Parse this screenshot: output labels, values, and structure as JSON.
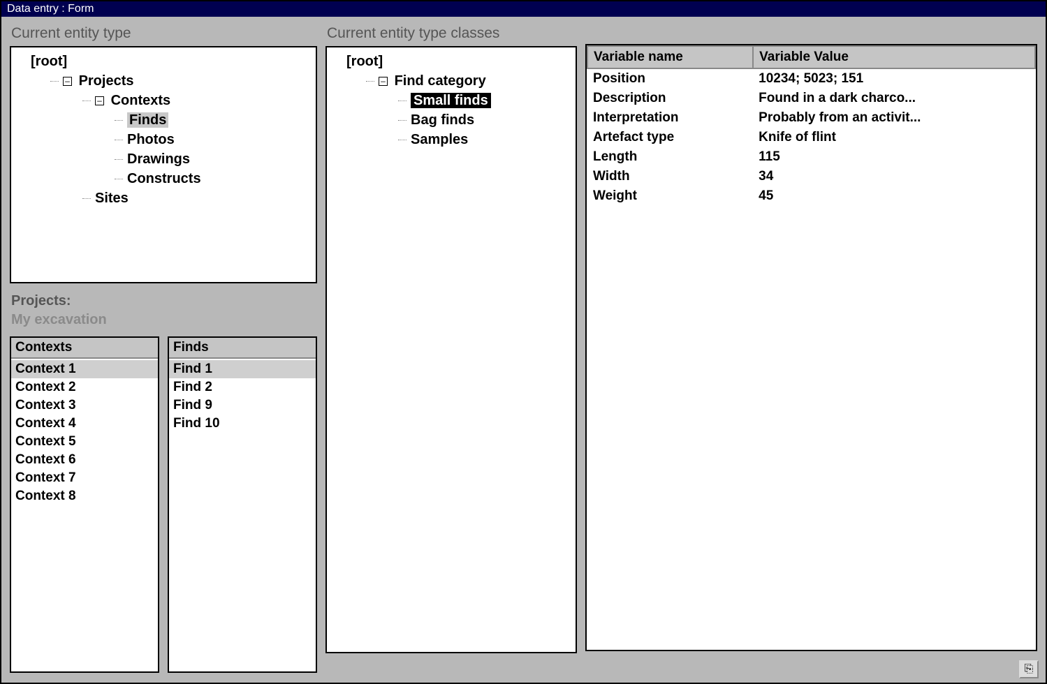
{
  "window": {
    "title": "Data entry : Form"
  },
  "entity_tree": {
    "title": "Current entity type",
    "root_label": "[root]",
    "nodes": {
      "projects": "Projects",
      "contexts": "Contexts",
      "finds": "Finds",
      "photos": "Photos",
      "drawings": "Drawings",
      "constructs": "Constructs",
      "sites": "Sites"
    },
    "selected": "Finds"
  },
  "classes_tree": {
    "title": "Current entity type classes",
    "root_label": "[root]",
    "nodes": {
      "find_category": "Find category",
      "small_finds": "Small finds",
      "bag_finds": "Bag finds",
      "samples": "Samples"
    },
    "selected": "Small finds"
  },
  "projects": {
    "label": "Projects:",
    "current": "My excavation"
  },
  "contexts_list": {
    "header": "Contexts",
    "items": [
      "Context 1",
      "Context 2",
      "Context 3",
      "Context 4",
      "Context 5",
      "Context 6",
      "Context 7",
      "Context 8"
    ],
    "selected_index": 0
  },
  "finds_list": {
    "header": "Finds",
    "items": [
      "Find 1",
      "Find 2",
      "Find 9",
      "Find 10"
    ],
    "selected_index": 0
  },
  "variables": {
    "col_name": "Variable name",
    "col_value": "Variable Value",
    "rows": [
      {
        "name": "Position",
        "value": "10234; 5023; 151"
      },
      {
        "name": "Description",
        "value": "Found in a dark charco..."
      },
      {
        "name": "Interpretation",
        "value": "Probably from an activit..."
      },
      {
        "name": "Artefact type",
        "value": "Knife of flint"
      },
      {
        "name": "Length",
        "value": "115"
      },
      {
        "name": "Width",
        "value": "34"
      },
      {
        "name": "Weight",
        "value": "45"
      }
    ]
  },
  "exit_button": {
    "glyph": "⎘"
  }
}
